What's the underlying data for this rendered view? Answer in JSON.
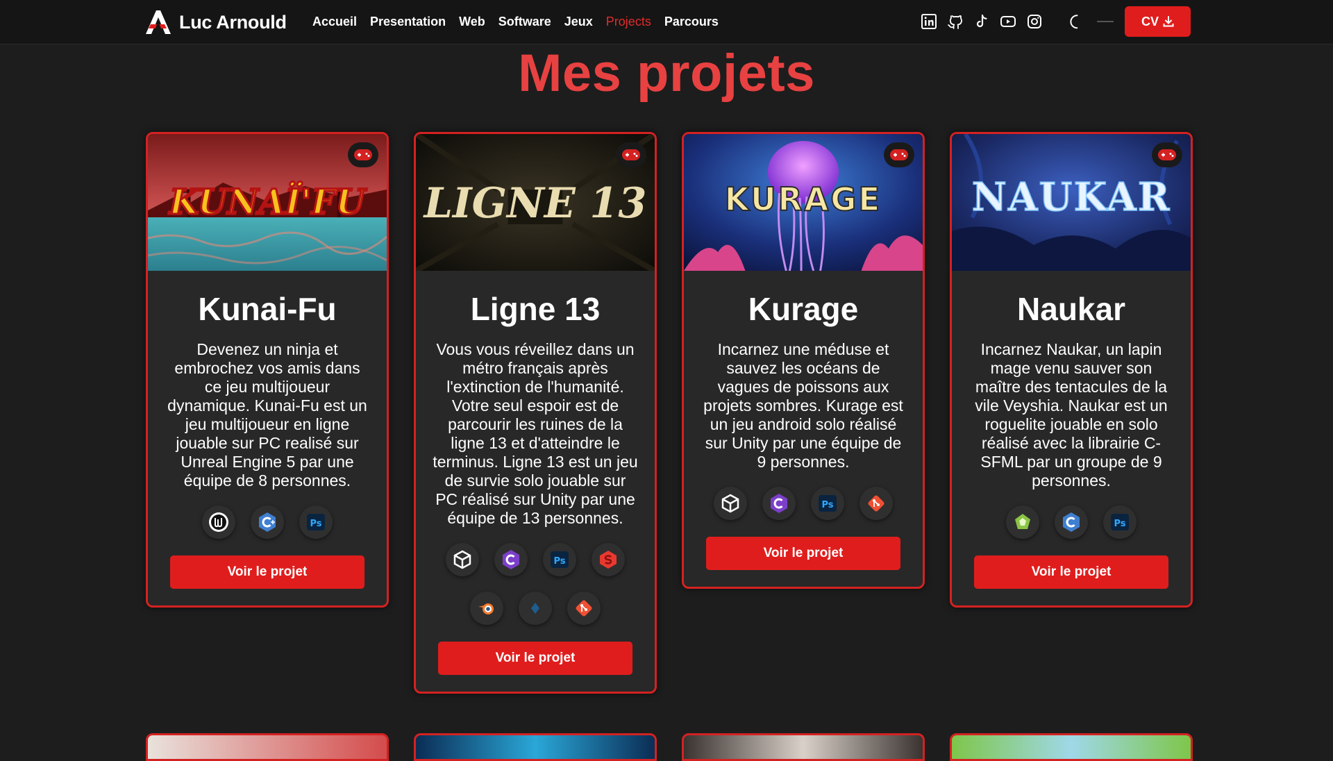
{
  "brand": {
    "name": "Luc Arnould"
  },
  "nav": {
    "links": [
      {
        "label": "Accueil",
        "active": false
      },
      {
        "label": "Presentation",
        "active": false
      },
      {
        "label": "Web",
        "active": false
      },
      {
        "label": "Software",
        "active": false
      },
      {
        "label": "Jeux",
        "active": false
      },
      {
        "label": "Projects",
        "active": true
      },
      {
        "label": "Parcours",
        "active": false
      }
    ],
    "socials": [
      "linkedin-icon",
      "github-icon",
      "tiktok-icon",
      "youtube-icon",
      "instagram-icon"
    ],
    "cv_label": "CV"
  },
  "colors": {
    "accent": "#e01d1d",
    "title": "#e84141",
    "background": "#1d1d1d",
    "card": "#282828"
  },
  "page": {
    "title": "Mes projets"
  },
  "projects": [
    {
      "title": "Kunai-Fu",
      "banner_text": "KUNAÏ'FU",
      "description": "Devenez un ninja et embrochez vos amis dans ce jeu multijoueur dynamique. Kunai-Fu est un jeu multijoueur en ligne jouable sur PC realisé sur Unreal Engine 5 par une équipe de 8 personnes.",
      "techs": [
        "unreal-engine-icon",
        "cpp-icon",
        "photoshop-icon"
      ],
      "button_label": "Voir le projet"
    },
    {
      "title": "Ligne 13",
      "banner_text": "LIGNE 13",
      "description": "Vous vous réveillez dans un métro français après l'extinction de l'humanité. Votre seul espoir est de parcourir les ruines de la ligne 13 et d'atteindre le terminus. Ligne 13 est un jeu de survie solo jouable sur PC réalisé sur Unity par une équipe de 13 personnes.",
      "techs": [
        "unity-icon",
        "csharp-icon",
        "photoshop-icon",
        "substance-icon",
        "blender-icon",
        "unknown-tool-icon",
        "git-icon"
      ],
      "button_label": "Voir le projet"
    },
    {
      "title": "Kurage",
      "banner_text": "KURAGE",
      "description": "Incarnez une méduse et sauvez les océans de vagues de poissons aux projets sombres. Kurage est un jeu android solo réalisé sur Unity par une équipe de 9 personnes.",
      "techs": [
        "unity-icon",
        "csharp-icon",
        "photoshop-icon",
        "git-icon"
      ],
      "button_label": "Voir le projet"
    },
    {
      "title": "Naukar",
      "banner_text": "NAUKAR",
      "description": "Incarnez Naukar, un lapin mage venu sauver son maître des tentacules de la vile Veyshia. Naukar est un roguelite jouable en solo réalisé avec la librairie C-SFML par un groupe de 9 personnes.",
      "techs": [
        "sfml-icon",
        "c-icon",
        "photoshop-icon"
      ],
      "button_label": "Voir le projet"
    }
  ]
}
